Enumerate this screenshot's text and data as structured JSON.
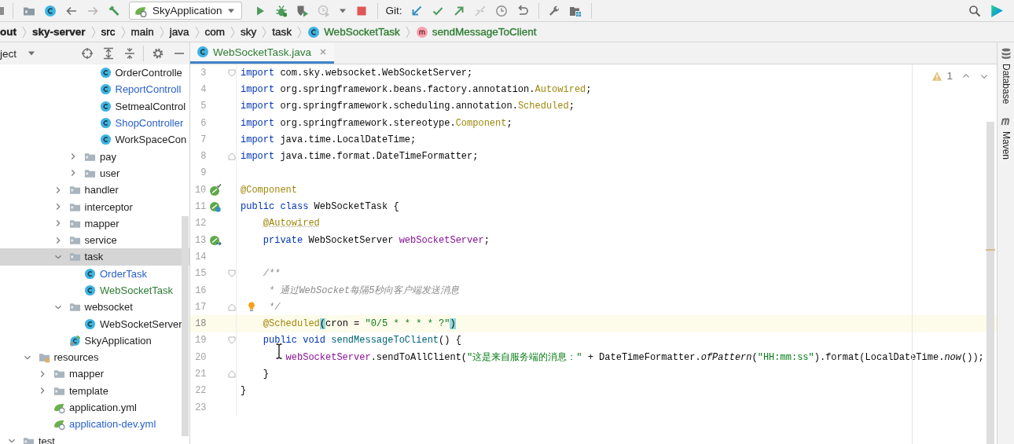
{
  "toolbar": [
    {
      "kind": "partial",
      "disabled": false
    },
    {
      "kind": "separator"
    },
    {
      "kind": "open",
      "disabled": false
    },
    {
      "kind": "class",
      "disabled": false
    },
    {
      "kind": "back",
      "disabled": false
    },
    {
      "kind": "forward",
      "disabled": true
    },
    {
      "kind": "build",
      "disabled": false
    },
    {
      "kind": "run-config",
      "label": "SkyApplication"
    },
    {
      "kind": "run",
      "disabled": false
    },
    {
      "kind": "debug",
      "disabled": false
    },
    {
      "kind": "coverage",
      "disabled": false
    },
    {
      "kind": "profile",
      "disabled": true
    },
    {
      "kind": "dropdown",
      "disabled": false
    },
    {
      "kind": "stop",
      "disabled": false
    },
    {
      "kind": "separator"
    },
    {
      "kind": "label",
      "text": "Git:"
    },
    {
      "kind": "update",
      "disabled": false
    },
    {
      "kind": "commit",
      "disabled": false
    },
    {
      "kind": "push",
      "disabled": false
    },
    {
      "kind": "merge",
      "disabled": true
    },
    {
      "kind": "history",
      "disabled": false
    },
    {
      "kind": "rollback",
      "disabled": false
    },
    {
      "kind": "separator"
    },
    {
      "kind": "settings",
      "disabled": false
    },
    {
      "kind": "structure",
      "disabled": false
    },
    {
      "kind": "separator"
    },
    {
      "kind": "spacer"
    },
    {
      "kind": "search",
      "disabled": false
    },
    {
      "kind": "logo",
      "disabled": false
    }
  ],
  "breadcrumb": [
    {
      "label": "out",
      "kind": "module",
      "color": "#1e1e1e"
    },
    {
      "label": "sky-server",
      "kind": "module",
      "color": "#1e1e1e"
    },
    {
      "label": "src",
      "kind": "folder",
      "color": "#000000"
    },
    {
      "label": "main",
      "kind": "folder",
      "color": "#1e1e1e"
    },
    {
      "label": "java",
      "kind": "folder",
      "color": "#1e1e1e"
    },
    {
      "label": "com",
      "kind": "folder",
      "color": "#1e1e1e"
    },
    {
      "label": "sky",
      "kind": "folder",
      "color": "#1e1e1e"
    },
    {
      "label": "task",
      "kind": "folder",
      "color": "#1e1e1e"
    },
    {
      "label": "WebSocketTask",
      "kind": "class",
      "color": "#2e7d32"
    },
    {
      "label": "sendMessageToClient",
      "kind": "method",
      "color": "#2e7d32"
    }
  ],
  "project_panel": {
    "title": "ject",
    "tree": [
      {
        "children": [
          {
            "children": [
              {
                "children": [
                  {
                    "children": [
                      {
                        "children": [
                          {
                            "label": "OrderControlle",
                            "kind": "class",
                            "selected": false,
                            "color": "#1e1e1e"
                          },
                          {
                            "label": "ReportControll",
                            "kind": "class",
                            "selected": false,
                            "color": "#2a62c9"
                          },
                          {
                            "label": "SetmealControl",
                            "kind": "class",
                            "selected": false,
                            "color": "#1e1e1e"
                          },
                          {
                            "label": "ShopController",
                            "kind": "class",
                            "selected": false,
                            "color": "#2a62c9"
                          },
                          {
                            "label": "WorkSpaceCon",
                            "kind": "class",
                            "selected": false,
                            "color": "#1e1e1e"
                          }
                        ]
                      },
                      {
                        "label": "pay",
                        "kind": "folder",
                        "expanded": false,
                        "selected": false,
                        "color": "#1e1e1e"
                      },
                      {
                        "label": "user",
                        "kind": "folder",
                        "expanded": false,
                        "selected": false,
                        "color": "#1e1e1e"
                      }
                    ]
                  },
                  {
                    "label": "handler",
                    "kind": "folder",
                    "expanded": false,
                    "selected": false,
                    "color": "#1e1e1e"
                  },
                  {
                    "label": "interceptor",
                    "kind": "folder",
                    "expanded": false,
                    "selected": false,
                    "color": "#1e1e1e"
                  },
                  {
                    "label": "mapper",
                    "kind": "folder",
                    "expanded": false,
                    "selected": false,
                    "color": "#1e1e1e"
                  },
                  {
                    "label": "service",
                    "kind": "folder",
                    "expanded": false,
                    "selected": false,
                    "color": "#1e1e1e"
                  },
                  {
                    "label": "task",
                    "kind": "folder",
                    "expanded": true,
                    "selected": true,
                    "color": "#1e1e1e",
                    "children": [
                      {
                        "label": "OrderTask",
                        "kind": "class",
                        "selected": false,
                        "color": "#2a62c9"
                      },
                      {
                        "label": "WebSocketTask",
                        "kind": "class",
                        "selected": false,
                        "color": "#2e7d32"
                      }
                    ]
                  },
                  {
                    "label": "websocket",
                    "kind": "folder",
                    "expanded": true,
                    "selected": false,
                    "color": "#1e1e1e",
                    "children": [
                      {
                        "label": "WebSocketServer",
                        "kind": "class",
                        "selected": false,
                        "color": "#1e1e1e"
                      }
                    ]
                  },
                  {
                    "label": "SkyApplication",
                    "kind": "spring-class",
                    "selected": false,
                    "color": "#1e1e1e"
                  }
                ]
              }
            ]
          },
          {
            "label": "resources",
            "kind": "resources",
            "expanded": true,
            "selected": false,
            "color": "#1e1e1e",
            "children": [
              {
                "label": "mapper",
                "kind": "folder",
                "expanded": false,
                "selected": false,
                "color": "#1e1e1e"
              },
              {
                "label": "template",
                "kind": "folder",
                "expanded": false,
                "selected": false,
                "color": "#1e1e1e"
              },
              {
                "label": "application.yml",
                "kind": "yml",
                "selected": false,
                "color": "#1e1e1e"
              },
              {
                "label": "application-dev.yml",
                "kind": "yml",
                "selected": false,
                "color": "#2a62c9"
              }
            ]
          }
        ]
      },
      {
        "label": "test",
        "kind": "folder",
        "expanded": true,
        "selected": false,
        "color": "#1e1e1e"
      }
    ]
  },
  "editor": {
    "tabs": [
      {
        "label": "WebSocketTask.java",
        "kind": "class",
        "selected": true,
        "color": "#2e7d32"
      }
    ],
    "inspection": {
      "warnings": "1"
    },
    "lines": [
      {
        "n": "3",
        "kind": "code",
        "fold_start": true,
        "fold_end": false,
        "current": false,
        "tokens": [
          {
            "kind": "kw",
            "text": "import"
          },
          {
            "kind": "plain",
            "text": " com.sky.websocket.WebSocketServer;"
          }
        ]
      },
      {
        "n": "4",
        "kind": "code",
        "fold_start": false,
        "fold_end": false,
        "current": false,
        "tokens": [
          {
            "kind": "kw",
            "text": "import"
          },
          {
            "kind": "plain",
            "text": " org.springframework.beans.factory.annotation."
          },
          {
            "kind": "annot",
            "text": "Autowired"
          },
          {
            "kind": "plain",
            "text": ";"
          }
        ]
      },
      {
        "n": "5",
        "kind": "code",
        "fold_start": false,
        "fold_end": false,
        "current": false,
        "tokens": [
          {
            "kind": "kw",
            "text": "import"
          },
          {
            "kind": "plain",
            "text": " org.springframework.scheduling.annotation."
          },
          {
            "kind": "annot",
            "text": "Scheduled"
          },
          {
            "kind": "plain",
            "text": ";"
          }
        ]
      },
      {
        "n": "6",
        "kind": "code",
        "fold_start": false,
        "fold_end": false,
        "current": false,
        "tokens": [
          {
            "kind": "kw",
            "text": "import"
          },
          {
            "kind": "plain",
            "text": " org.springframework.stereotype."
          },
          {
            "kind": "annot",
            "text": "Component"
          },
          {
            "kind": "plain",
            "text": ";"
          }
        ]
      },
      {
        "n": "7",
        "kind": "code",
        "fold_start": false,
        "fold_end": false,
        "current": false,
        "tokens": [
          {
            "kind": "kw",
            "text": "import"
          },
          {
            "kind": "plain",
            "text": " java.time.LocalDateTime;"
          }
        ]
      },
      {
        "n": "8",
        "kind": "code",
        "fold_start": false,
        "fold_end": true,
        "current": false,
        "tokens": [
          {
            "kind": "kw",
            "text": "import"
          },
          {
            "kind": "plain",
            "text": " java.time.format.DateTimeFormatter;"
          }
        ]
      },
      {
        "n": "9",
        "kind": "code",
        "fold_start": false,
        "fold_end": false,
        "current": false
      },
      {
        "n": "10",
        "kind": "bean",
        "fold_start": false,
        "fold_end": false,
        "current": false,
        "tokens": [
          {
            "kind": "annot",
            "text": "@Component"
          }
        ]
      },
      {
        "n": "11",
        "kind": "bean-class",
        "fold_start": false,
        "fold_end": false,
        "current": false,
        "tokens": [
          {
            "kind": "kw",
            "text": "public class"
          },
          {
            "kind": "plain",
            "text": " WebSocketTask {"
          }
        ]
      },
      {
        "n": "12",
        "kind": "code",
        "fold_start": false,
        "fold_end": false,
        "current": false,
        "tokens": [
          {
            "kind": "annot-warn",
            "text": "    @Autowired"
          }
        ]
      },
      {
        "n": "13",
        "kind": "bean-inject",
        "fold_start": false,
        "fold_end": false,
        "current": false,
        "tokens": [
          {
            "kind": "kw",
            "text": "    private"
          },
          {
            "kind": "plain",
            "text": " WebSocketServer "
          },
          {
            "kind": "field",
            "text": "webSocketServer"
          },
          {
            "kind": "plain",
            "text": ";"
          }
        ]
      },
      {
        "n": "14",
        "kind": "code",
        "fold_start": false,
        "fold_end": false,
        "current": false
      },
      {
        "n": "15",
        "kind": "code",
        "fold_start": true,
        "fold_end": false,
        "current": false,
        "tokens": [
          {
            "kind": "comment",
            "text": "    /**"
          }
        ]
      },
      {
        "n": "16",
        "kind": "code",
        "fold_start": false,
        "fold_end": false,
        "current": false,
        "tokens": [
          {
            "kind": "comment",
            "text": "     * 通过WebSocket每隔5秒向客户端发送消息"
          }
        ]
      },
      {
        "n": "17",
        "kind": "bulb",
        "fold_start": false,
        "fold_end": true,
        "current": false,
        "tokens": [
          {
            "kind": "comment",
            "text": "     */"
          }
        ]
      },
      {
        "n": "18",
        "kind": "code",
        "fold_start": false,
        "fold_end": false,
        "current": true,
        "tokens": [
          {
            "kind": "annot",
            "text": "    @Scheduled"
          },
          {
            "kind": "paren-match",
            "text": "("
          },
          {
            "kind": "plain",
            "text": "cron = "
          },
          {
            "kind": "string",
            "text": "\"0/5 * * * * ?\""
          },
          {
            "kind": "paren-match",
            "text": ")"
          }
        ]
      },
      {
        "n": "19",
        "kind": "code",
        "fold_start": true,
        "fold_end": false,
        "current": false,
        "tokens": [
          {
            "kind": "kw",
            "text": "    public void"
          },
          {
            "kind": "method",
            "text": " sendMessageToClient"
          },
          {
            "kind": "plain",
            "text": "() {"
          }
        ]
      },
      {
        "n": "20",
        "kind": "code",
        "fold_start": false,
        "fold_end": false,
        "current": false,
        "tokens": [
          {
            "kind": "field",
            "text": "        webSocketServer"
          },
          {
            "kind": "plain",
            "text": ".sendToAllClient("
          },
          {
            "kind": "string",
            "text": "\"这是来自服务端的消息：\""
          },
          {
            "kind": "plain",
            "text": " + DateTimeFormatter."
          },
          {
            "kind": "static",
            "text": "ofPattern"
          },
          {
            "kind": "plain",
            "text": "("
          },
          {
            "kind": "string",
            "text": "\"HH:mm:ss\""
          },
          {
            "kind": "plain",
            "text": ").format(LocalDateTime."
          },
          {
            "kind": "static",
            "text": "now"
          },
          {
            "kind": "plain",
            "text": "());"
          }
        ]
      },
      {
        "n": "21",
        "kind": "code",
        "fold_start": false,
        "fold_end": true,
        "current": false,
        "tokens": [
          {
            "kind": "plain",
            "text": "    }"
          }
        ]
      },
      {
        "n": "22",
        "kind": "code",
        "fold_start": false,
        "fold_end": false,
        "current": false,
        "tokens": [
          {
            "kind": "plain",
            "text": "}"
          }
        ]
      },
      {
        "n": "23",
        "kind": "code",
        "fold_start": false,
        "fold_end": false,
        "current": false
      }
    ]
  },
  "right_toolbar": [
    {
      "kind": "database",
      "label": "Database"
    },
    {
      "kind": "maven",
      "label": "Maven"
    }
  ]
}
